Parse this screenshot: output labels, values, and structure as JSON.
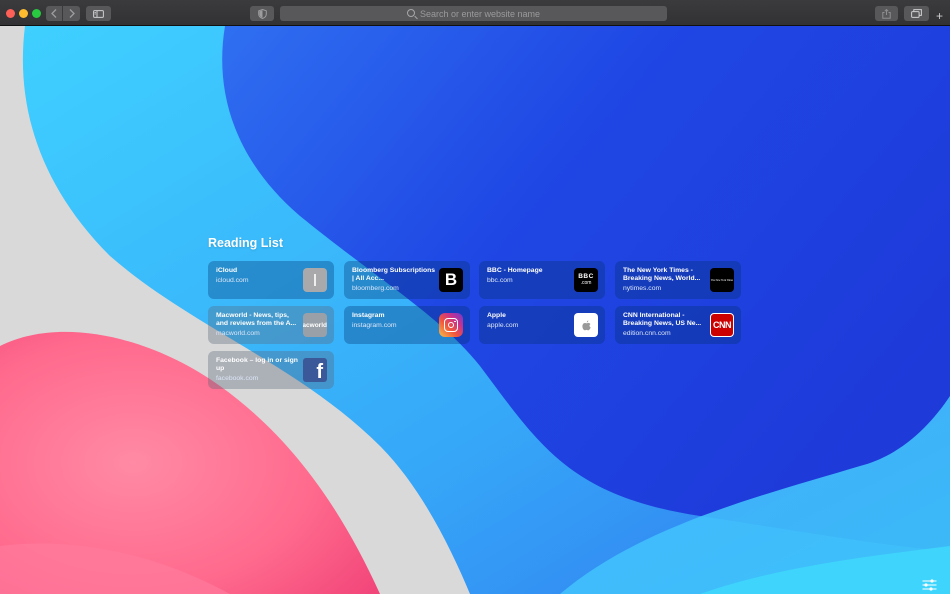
{
  "toolbar": {
    "address_placeholder": "Search or enter website name",
    "new_tab_symbol": "+"
  },
  "reading_list": {
    "title": "Reading List",
    "items": [
      {
        "title": "iCloud",
        "url": "icloud.com",
        "icon": "icloud-icon",
        "icon_text": ""
      },
      {
        "title": "Bloomberg Subscriptions | All Acc...",
        "url": "bloomberg.com",
        "icon": "bloomberg-icon",
        "icon_text": "B"
      },
      {
        "title": "BBC - Homepage",
        "url": "bbc.com",
        "icon": "bbc-icon",
        "icon_text": "BBC"
      },
      {
        "title": "The New York Times - Breaking News, World...",
        "url": "nytimes.com",
        "icon": "nytimes-icon",
        "icon_text": "The New York Times"
      },
      {
        "title": "Macworld - News, tips, and reviews from the A...",
        "url": "macworld.com",
        "icon": "macworld-icon",
        "icon_text": "Macworld"
      },
      {
        "title": "Instagram",
        "url": "instagram.com",
        "icon": "instagram-icon",
        "icon_text": ""
      },
      {
        "title": "Apple",
        "url": "apple.com",
        "icon": "apple-icon",
        "icon_text": ""
      },
      {
        "title": "CNN International - Breaking News, US Ne...",
        "url": "edition.cnn.com",
        "icon": "cnn-icon",
        "icon_text": "CNN"
      },
      {
        "title": "Facebook – log in or sign up",
        "url": "facebook.com",
        "icon": "facebook-icon",
        "icon_text": "f"
      }
    ]
  },
  "colors": {
    "blue_deep": "#1d3fe0",
    "blue_light": "#3fc3f7",
    "pink": "#ff6f91",
    "grey": "#d9d9d9"
  }
}
